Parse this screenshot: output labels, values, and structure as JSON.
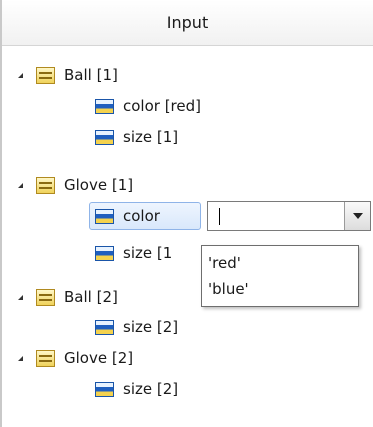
{
  "header": {
    "title": "Input"
  },
  "tree": [
    {
      "label": "Ball [1]",
      "children": [
        "color [red]",
        "size [1]"
      ]
    },
    {
      "label": "Glove [1]",
      "children": [
        "color",
        "size [1"
      ]
    },
    {
      "label": "Ball [2]",
      "children": [
        "size [2]"
      ]
    },
    {
      "label": "Glove [2]",
      "children": [
        "size [2]"
      ]
    }
  ],
  "editor": {
    "value": "",
    "options": [
      "'red'",
      "'blue'"
    ]
  },
  "icons": {
    "object": "object-icon",
    "property": "property-icon",
    "expander": "expanded-triangle-icon",
    "dropdown": "chevron-down-icon"
  }
}
